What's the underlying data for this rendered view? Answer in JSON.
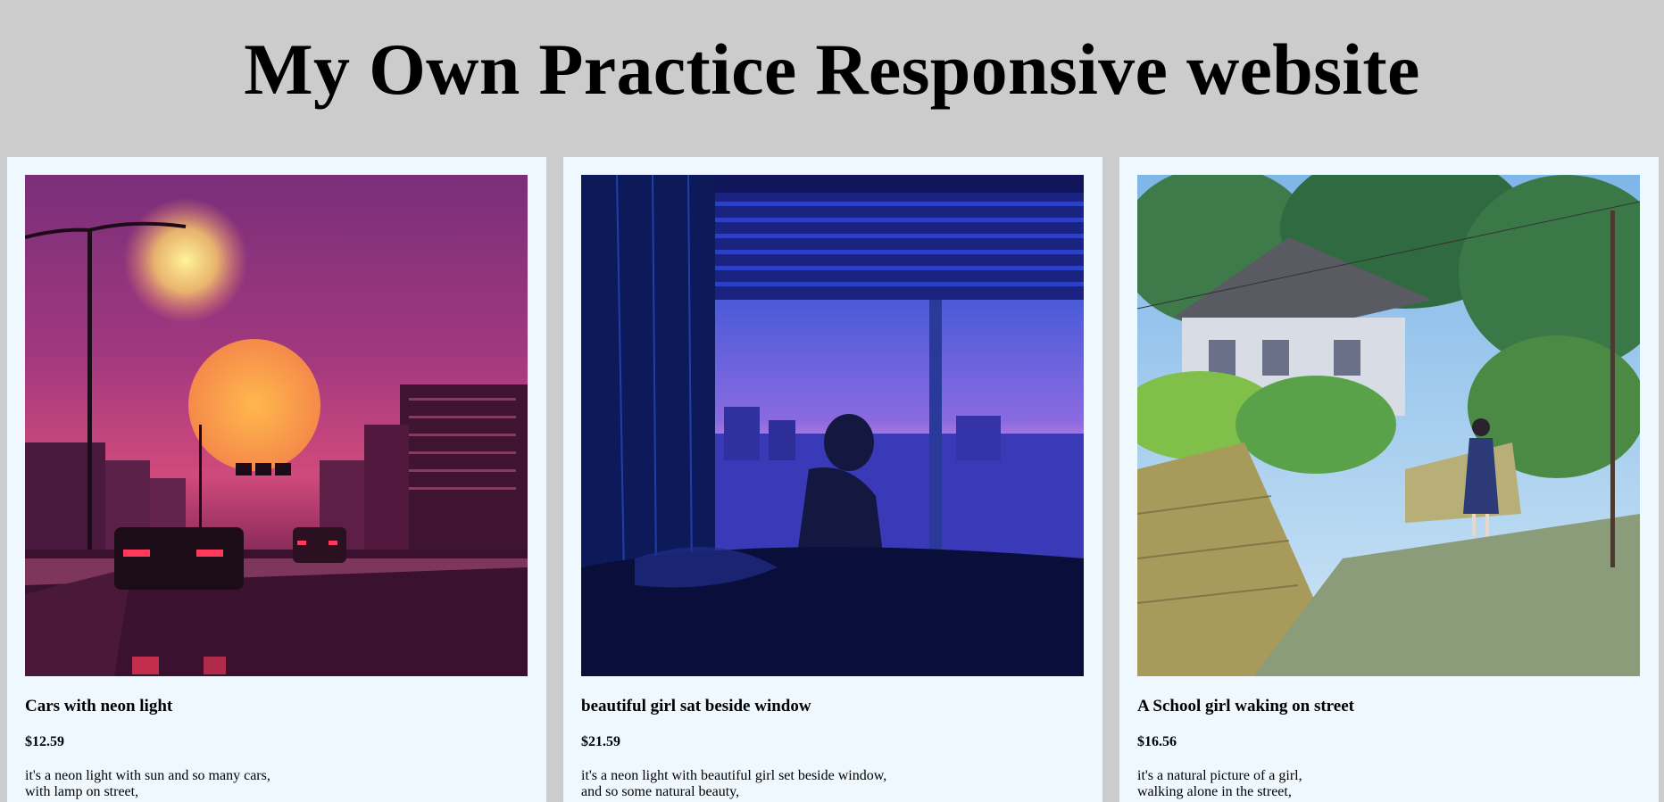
{
  "header": {
    "title": "My Own Practice Responsive website"
  },
  "products": [
    {
      "image": "neon-highway-sunset-image",
      "title": "Cars with neon light",
      "price": "$12.59",
      "description_lines": [
        "it's a neon light with sun and so many cars,",
        "with lamp on street,"
      ]
    },
    {
      "image": "girl-beside-window-night-image",
      "title": "beautiful girl sat beside window",
      "price": "$21.59",
      "description_lines": [
        "it's a neon light with beautiful girl set beside window,",
        "and so some natural beauty,"
      ]
    },
    {
      "image": "school-girl-street-image",
      "title": "A School girl waking on street",
      "price": "$16.56",
      "description_lines": [
        "it's a natural picture of a girl,",
        "walking alone in the street,"
      ]
    }
  ],
  "colors": {
    "page_background": "#cccccc",
    "card_background": "#f0f8ff"
  }
}
